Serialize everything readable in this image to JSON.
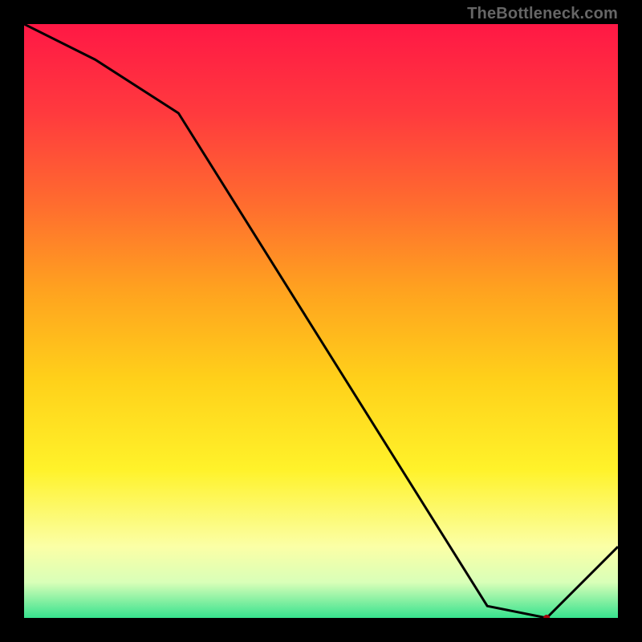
{
  "attribution": "TheBottleneck.com",
  "marker_label": "",
  "chart_data": {
    "type": "line",
    "title": "",
    "xlabel": "",
    "ylabel": "",
    "xlim": [
      0,
      100
    ],
    "ylim": [
      0,
      100
    ],
    "series": [
      {
        "name": "curve",
        "x": [
          0,
          12,
          26,
          78,
          88,
          100
        ],
        "y": [
          100,
          94,
          85,
          2,
          0,
          12
        ]
      }
    ],
    "marker": {
      "x": 88,
      "y": 0
    },
    "colors": {
      "curve": "#000000",
      "marker": "#a4000b",
      "gradient_top": "#ff1845",
      "gradient_bottom": "#37e28e",
      "background": "#000000"
    }
  }
}
